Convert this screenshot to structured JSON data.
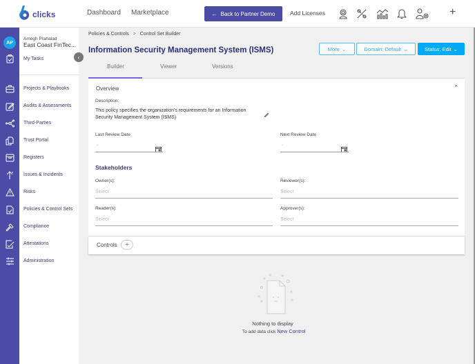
{
  "topbar": {
    "logo_text": "clicks",
    "nav": [
      "Dashboard",
      "Marketplace"
    ],
    "back_button": "Back to Partner Demo",
    "add_licenses": "Add Licenses",
    "icons": [
      "support-agent-icon",
      "tools-icon",
      "analytics-icon",
      "bell-icon",
      "user-settings-icon"
    ],
    "plus": "+"
  },
  "user": {
    "initials": "AP",
    "name": "Amogh Prahalad",
    "org": "East Coast FinTec..."
  },
  "sidebar": {
    "top_item": "My Tasks",
    "items": [
      {
        "label": "Projects & Playbooks",
        "icon": "briefcase-icon"
      },
      {
        "label": "Audits & Assessments",
        "icon": "edit-square-icon"
      },
      {
        "label": "Third-Parties",
        "icon": "network-icon"
      },
      {
        "label": "Trust Portal",
        "icon": "documents-icon"
      },
      {
        "label": "Registers",
        "icon": "register-box-icon"
      },
      {
        "label": "Issues & Incidents",
        "icon": "issue-arrow-icon"
      },
      {
        "label": "Risks",
        "icon": "warning-icon"
      },
      {
        "label": "Policies & Control Sets",
        "icon": "policy-doc-icon"
      },
      {
        "label": "Compliance",
        "icon": "gavel-icon"
      },
      {
        "label": "Attestations",
        "icon": "attestation-icon"
      },
      {
        "label": "Administration",
        "icon": "sliders-icon"
      }
    ]
  },
  "breadcrumb": {
    "parent": "Policies & Controls",
    "separator": ">",
    "current": "Control Set Builder"
  },
  "page": {
    "title": "Information Security Management System (ISMS)",
    "more": "More",
    "domain": "Domain: Default",
    "status": "Status: Edit"
  },
  "tabs": [
    "Builder",
    "Viewer",
    "Versions"
  ],
  "overview": {
    "title": "Overview",
    "description_label": "Description:",
    "description": "This policy specifies the organization's requirements for an Information Security Management System (ISMS)",
    "last_review_label": "Last Review Date",
    "last_review_value": "-",
    "next_review_label": "Next Review Date",
    "next_review_value": "-",
    "stakeholders_title": "Stakeholders",
    "owners_label": "Owner(s):",
    "reviewers_label": "Reviewer(s):",
    "readers_label": "Reader(s):",
    "approvers_label": "Approver(s):",
    "select_placeholder": "Select"
  },
  "controls": {
    "title": "Controls"
  },
  "empty_state": {
    "title": "Nothing to display",
    "prefix": "To add data click",
    "link": "New Control"
  }
}
